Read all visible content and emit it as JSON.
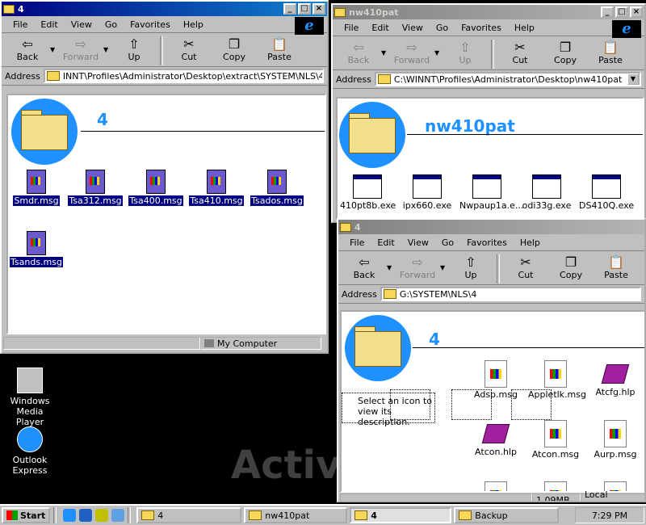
{
  "menu": [
    "File",
    "Edit",
    "View",
    "Go",
    "Favorites",
    "Help"
  ],
  "toolbar": {
    "back": "Back",
    "forward": "Forward",
    "up": "Up",
    "cut": "Cut",
    "copy": "Copy",
    "paste": "Paste"
  },
  "address_label": "Address",
  "win1": {
    "title": "4",
    "address": "INNT\\Profiles\\Administrator\\Desktop\\extract\\SYSTEM\\NLS\\4",
    "folder_title": "4",
    "files": [
      "Smdr.msg",
      "Tsa312.msg",
      "Tsa400.msg",
      "Tsa410.msg",
      "Tsados.msg",
      "Tsands.msg"
    ],
    "status": "My Computer"
  },
  "win2": {
    "title": "nw410pat",
    "address": "C:\\WINNT\\Profiles\\Administrator\\Desktop\\nw410pat",
    "folder_title": "nw410pat",
    "files": [
      "410pt8b.exe",
      "ipx660.exe",
      "Nwpaup1a.e...",
      "odi33g.exe",
      "DS410Q.exe"
    ]
  },
  "win3": {
    "title": "4",
    "address": "G:\\SYSTEM\\NLS\\4",
    "folder_title": "4",
    "description": "Select an icon to view its description.",
    "files": [
      "Adsp.msg",
      "Appletlk.msg",
      "Atcfg.hlp",
      "Atcon.hlp",
      "Atcon.msg",
      "Aurp.msg"
    ],
    "status_size": "1.09MB",
    "status_zone": "Local intranet"
  },
  "desktop": {
    "wmp": "Windows Media Player",
    "oe": "Outlook Express",
    "watermark": "Activ"
  },
  "taskbar": {
    "start": "Start",
    "buttons": [
      "4",
      "nw410pat",
      "4",
      "Backup"
    ],
    "clock": "7:29 PM"
  }
}
